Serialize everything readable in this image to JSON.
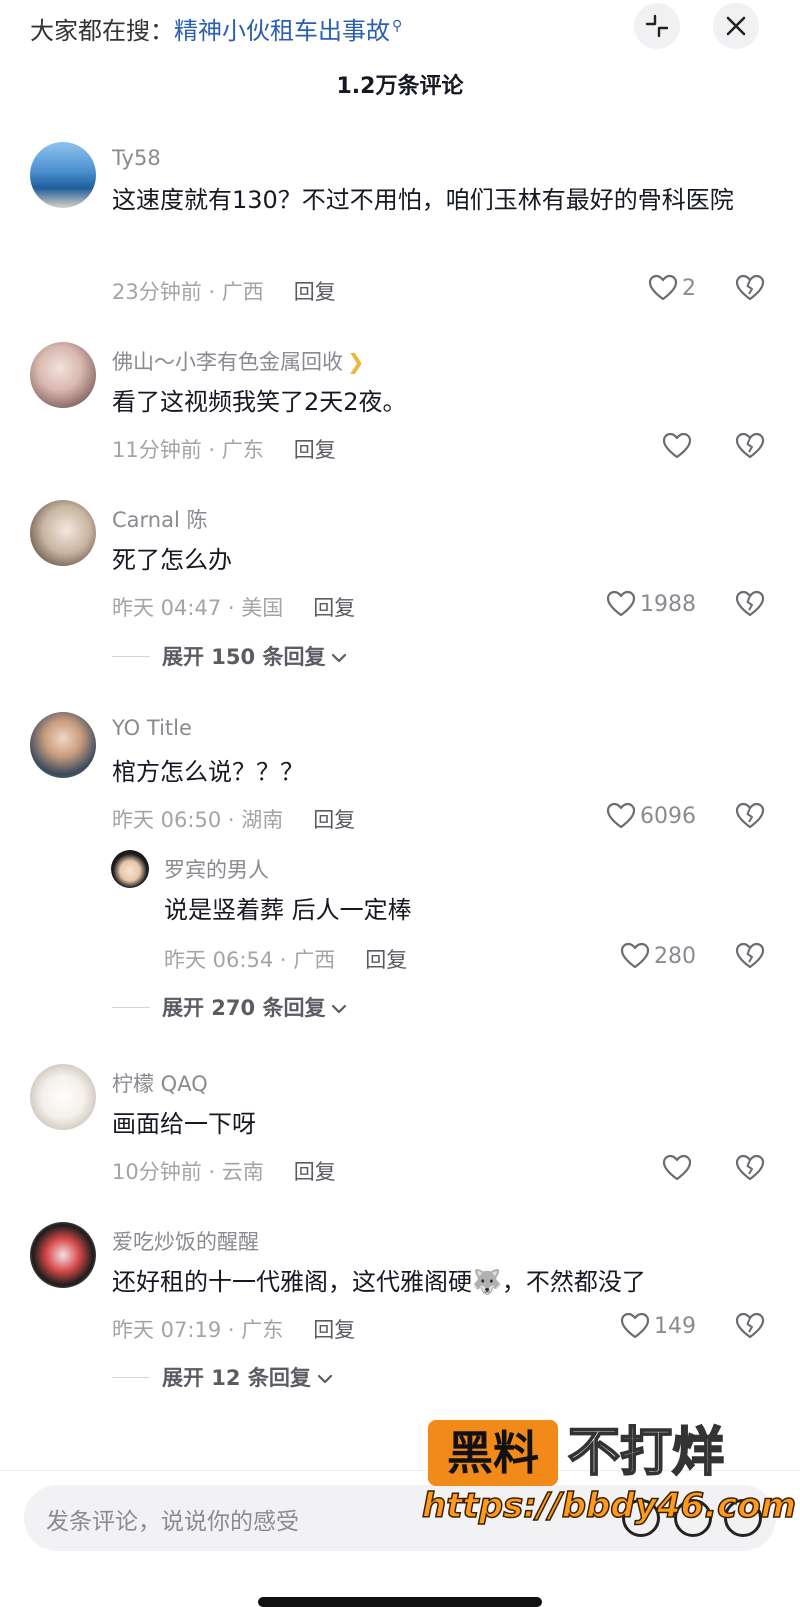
{
  "header": {
    "search_prefix": "大家都在搜：",
    "search_keyword": "精神小伙租车出事故",
    "comment_count": "1.2万条评论"
  },
  "comments": [
    {
      "username": "Ty58",
      "text": "这速度就有130？不过不用怕，咱们玉林有最好的骨科医院",
      "time_location": "23分钟前 · 广西",
      "reply_label": "回复",
      "likes": "2"
    },
    {
      "username": "佛山～小李有色金属回收",
      "text": "看了这视频我笑了2天2夜。",
      "time_location": "11分钟前 · 广东",
      "reply_label": "回复",
      "likes": ""
    },
    {
      "username": "Carnal 陈",
      "text": "死了怎么办",
      "time_location": "昨天 04:47 · 美国",
      "reply_label": "回复",
      "likes": "1988",
      "expand": "展开 150 条回复"
    },
    {
      "username": "YO  Title",
      "text": "棺方怎么说？？？",
      "time_location": "昨天 06:50 · 湖南",
      "reply_label": "回复",
      "likes": "6096",
      "sub_reply": {
        "username": "罗宾的男人",
        "text": "说是竖着葬 后人一定棒",
        "time_location": "昨天 06:54 · 广西",
        "reply_label": "回复",
        "likes": "280"
      },
      "expand": "展开 270 条回复"
    },
    {
      "username": "柠檬 QAQ",
      "text": "画面给一下呀",
      "time_location": "10分钟前 · 云南",
      "reply_label": "回复",
      "likes": ""
    },
    {
      "username": "爱吃炒饭的醒醒",
      "text": "还好租的十一代雅阁，这代雅阁硬🐺，不然都没了",
      "time_location": "昨天 07:19 · 广东",
      "reply_label": "回复",
      "likes": "149",
      "expand": "展开 12 条回复"
    }
  ],
  "footer": {
    "input_placeholder": "发条评论，说说你的感受"
  },
  "watermark": {
    "badge": "黑料",
    "text": "不打烊",
    "url": "https://bbdy46.com"
  },
  "icons": {
    "collapse": "collapse-icon",
    "close": "close-icon",
    "like": "heart-icon",
    "dislike": "broken-heart-icon",
    "chevron": "chevron-down-icon",
    "emoji": "emoji-icon",
    "at": "at-icon"
  }
}
